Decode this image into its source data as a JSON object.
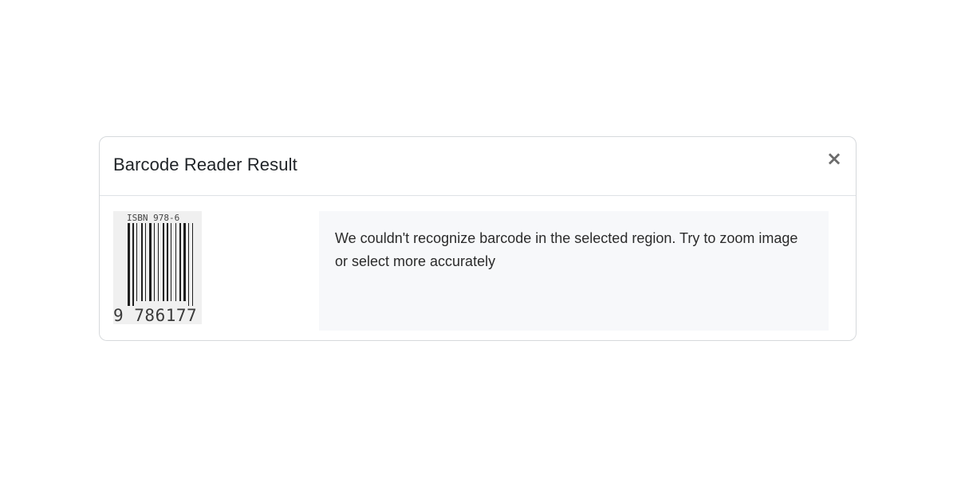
{
  "dialog": {
    "title": "Barcode Reader Result",
    "close_label": "×",
    "close_icon": "close-icon"
  },
  "barcode_image": {
    "isbn_text": "ISBN 978-6",
    "digits_text": "9 786177"
  },
  "result": {
    "message": "We couldn't recognize barcode in the selected region. Try to zoom image or select more accurately"
  }
}
